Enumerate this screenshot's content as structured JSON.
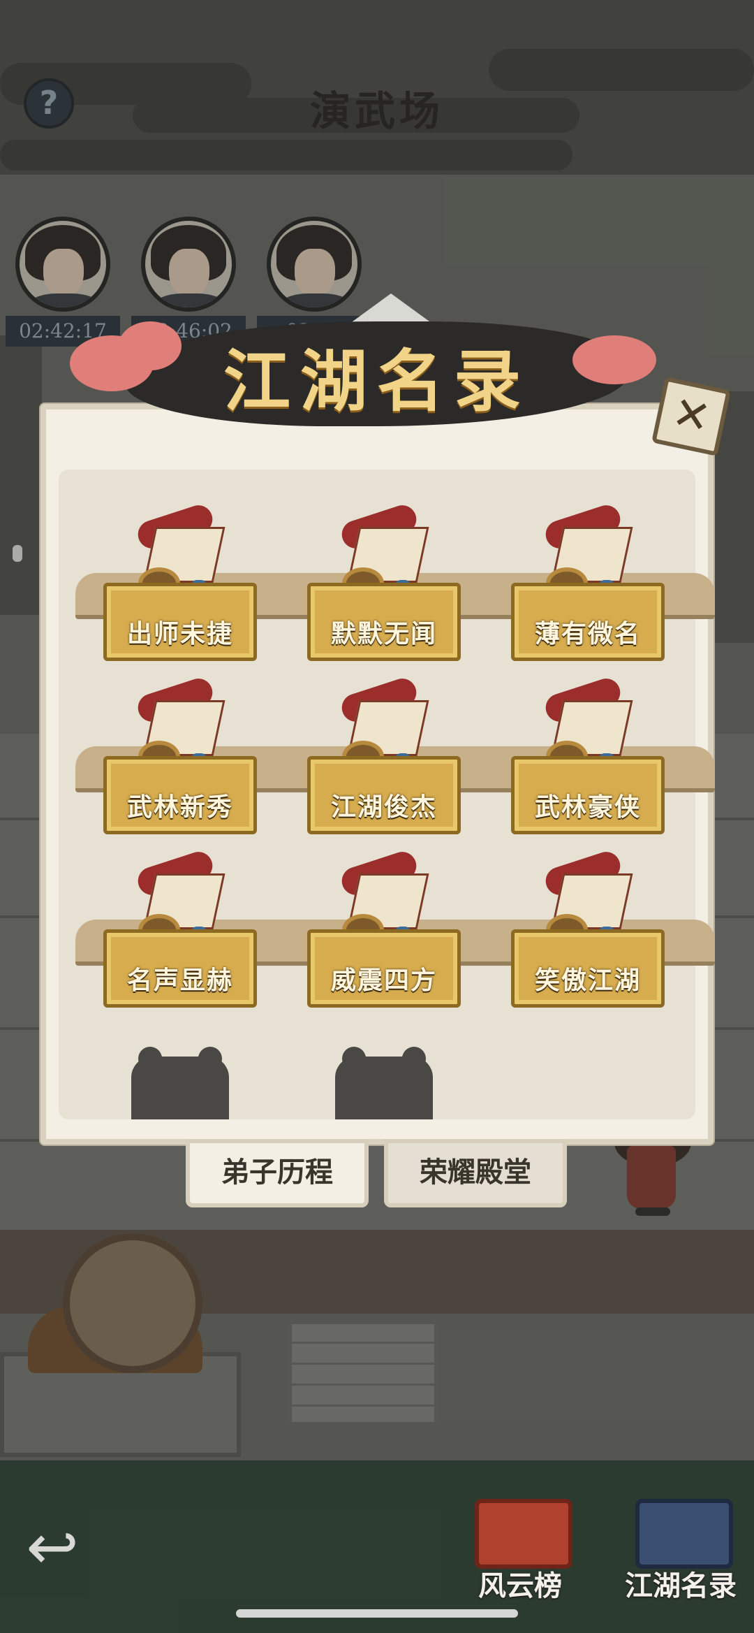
{
  "header": {
    "title": "演武场",
    "help_icon": "question-mark-icon"
  },
  "disciples": [
    {
      "timer": "02:42:17"
    },
    {
      "timer": "02:46:02"
    },
    {
      "timer": "02:50"
    }
  ],
  "modal": {
    "title": "江湖名录",
    "close_icon": "close-x-icon",
    "titles": [
      {
        "label": "出师未捷"
      },
      {
        "label": "默默无闻"
      },
      {
        "label": "薄有微名"
      },
      {
        "label": "武林新秀"
      },
      {
        "label": "江湖俊杰"
      },
      {
        "label": "武林豪侠"
      },
      {
        "label": "名声显赫"
      },
      {
        "label": "威震四方"
      },
      {
        "label": "笑傲江湖"
      }
    ],
    "locked_count_visible": 2,
    "tabs": [
      {
        "label": "弟子历程",
        "selected": true
      },
      {
        "label": "荣耀殿堂",
        "selected": false
      }
    ]
  },
  "bottom_bar": {
    "back_icon": "back-arrow-icon",
    "items": [
      {
        "label": "风云榜",
        "icon": "ranking-scroll-icon"
      },
      {
        "label": "江湖名录",
        "icon": "book-icon"
      }
    ]
  },
  "colors": {
    "modal_bg": "#f3efe5",
    "plaque_gold": "#d6ac4e",
    "banner_text": "#f2d488",
    "scroll_red": "#9b2d2a"
  }
}
